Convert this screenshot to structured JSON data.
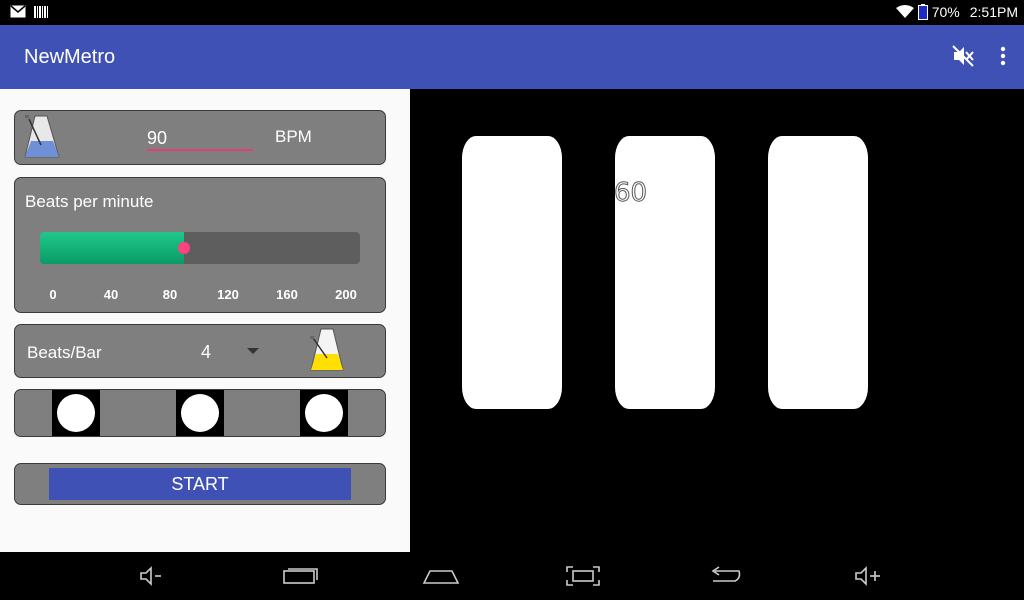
{
  "status_bar": {
    "battery": "70%",
    "time": "2:51PM"
  },
  "app_bar": {
    "title": "NewMetro",
    "icons": [
      "mute-icon",
      "more-vert-icon"
    ]
  },
  "tempo": {
    "bpm_value": "90",
    "bpm_unit": "BPM"
  },
  "slider": {
    "title": "Beats per minute",
    "ticks": [
      "0",
      "40",
      "80",
      "120",
      "160",
      "200"
    ],
    "level_fraction": 0.45,
    "fill_color": "#1fc88b",
    "thumb_color": "#ff4081"
  },
  "beats_per_bar": {
    "label": "Beats/Bar",
    "value": "4"
  },
  "start": {
    "label": "START"
  },
  "display": {
    "beat_number": "60"
  },
  "colors": {
    "primary": "#3f51b5",
    "accent": "#e0407a"
  }
}
